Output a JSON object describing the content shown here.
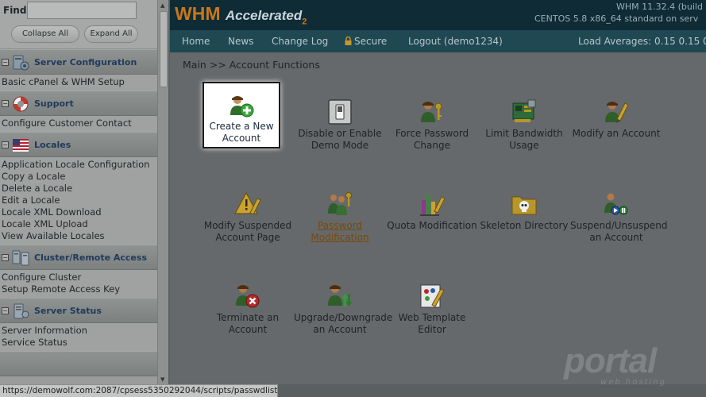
{
  "sidebar": {
    "find_label": "Find",
    "find_value": "",
    "collapse_all": "Collapse All",
    "expand_all": "Expand All",
    "sections": [
      {
        "title": "Server Configuration",
        "icon": "server-config-icon",
        "links": [
          "Basic cPanel & WHM Setup"
        ]
      },
      {
        "title": "Support",
        "icon": "lifebuoy-icon",
        "links": [
          "Configure Customer Contact"
        ]
      },
      {
        "title": "Locales",
        "icon": "us-flag-icon",
        "links": [
          "Application Locale Configuration",
          "Copy a Locale",
          "Delete a Locale",
          "Edit a Locale",
          "Locale XML Download",
          "Locale XML Upload",
          "View Available Locales"
        ]
      },
      {
        "title": "Cluster/Remote Access",
        "icon": "cluster-icon",
        "links": [
          "Configure Cluster",
          "Setup Remote Access Key"
        ]
      },
      {
        "title": "Server Status",
        "icon": "server-status-icon",
        "links": [
          "Server Information",
          "Service Status"
        ]
      }
    ]
  },
  "header": {
    "logo_main": "WHM",
    "logo_accent": "Accelerated",
    "logo_sub": "2",
    "version": "WHM 11.32.4 (build",
    "os": "CENTOS 5.8 x86_64 standard on serv"
  },
  "nav": {
    "home": "Home",
    "news": "News",
    "change_log": "Change Log",
    "secure": "Secure",
    "logout": "Logout (demo1234)",
    "load_averages": "Load Averages: 0.15 0.15 0"
  },
  "main": {
    "breadcrumb": "Main >> Account Functions",
    "functions": [
      {
        "label": "Create a New Account",
        "icon": "user-add-icon"
      },
      {
        "label": "Disable or Enable Demo Mode",
        "icon": "switch-icon"
      },
      {
        "label": "Force Password Change",
        "icon": "user-key-icon"
      },
      {
        "label": "Limit Bandwidth Usage",
        "icon": "network-card-icon"
      },
      {
        "label": "Modify an Account",
        "icon": "user-pencil-icon"
      },
      {
        "label": "Modify Suspended Account Page",
        "icon": "warning-pencil-icon"
      },
      {
        "label": "Password Modification",
        "icon": "users-key-icon"
      },
      {
        "label": "Quota Modification",
        "icon": "quota-chart-icon"
      },
      {
        "label": "Skeleton Directory",
        "icon": "skull-folder-icon"
      },
      {
        "label": "Suspend/Unsuspend an Account",
        "icon": "user-toggle-icon"
      },
      {
        "label": "Terminate an Account",
        "icon": "user-delete-icon"
      },
      {
        "label": "Upgrade/Downgrade an Account",
        "icon": "user-arrows-icon"
      },
      {
        "label": "Web Template Editor",
        "icon": "template-palette-icon"
      }
    ]
  },
  "status_bar": "https://demowolf.com:2087/cpsess5350292044/scripts/passwdlist",
  "watermark": {
    "text": "portal",
    "sub": "web hosting"
  },
  "colors": {
    "header_bg": "#0f2b35",
    "nav_bg": "#1f4852",
    "logo_orange": "#c8781a",
    "visited_link": "#7a4a08"
  }
}
